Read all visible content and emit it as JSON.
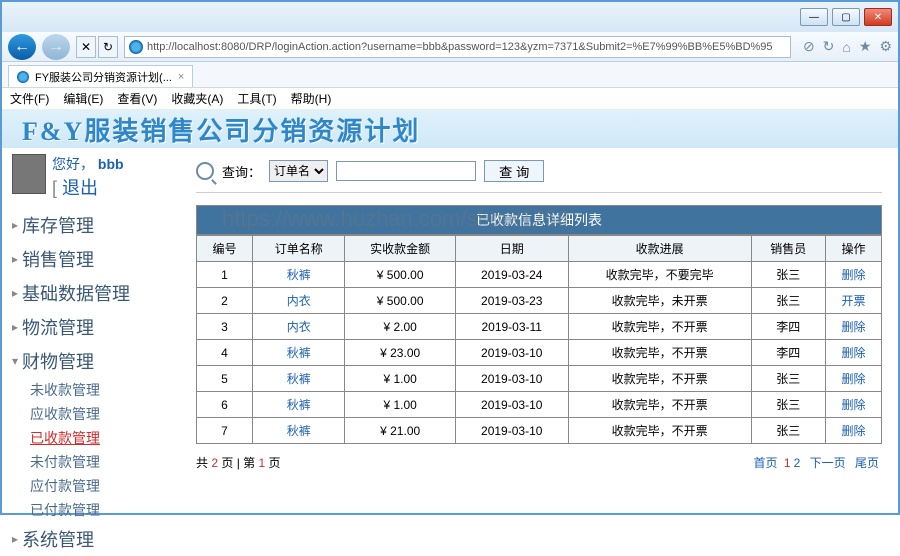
{
  "window": {
    "url_display": "http://localhost:8080/DRP/loginAction.action?username=bbb&password=123&yzm=7371&Submit2=%E7%99%BB%E5%BD%95",
    "tab_title": "FY服装公司分销资源计划(...",
    "min": "—",
    "max": "▢",
    "close": "✕"
  },
  "menu": [
    "文件(F)",
    "编辑(E)",
    "查看(V)",
    "收藏夹(A)",
    "工具(T)",
    "帮助(H)"
  ],
  "banner": "F&Y服装销售公司分销资源计划",
  "sidebar": {
    "hello_prefix": "您好，",
    "username": "bbb",
    "logout": "退出",
    "top_items": [
      "库存管理",
      "销售管理",
      "基础数据管理",
      "物流管理",
      "财物管理",
      "系统管理"
    ],
    "open_index": 4,
    "sub_items": [
      "未收款管理",
      "应收款管理",
      "已收款管理",
      "未付款管理",
      "应付款管理",
      "已付款管理"
    ],
    "active_sub_index": 2
  },
  "search": {
    "label": "查询：",
    "select_value": "订单名",
    "input_value": "",
    "button": "查 询"
  },
  "table": {
    "title": "已收款信息详细列表",
    "headers": [
      "编号",
      "订单名称",
      "实收款金额",
      "日期",
      "收款进展",
      "销售员",
      "操作"
    ],
    "rows": [
      {
        "id": "1",
        "name": "秋裤",
        "amount": "¥ 500.00",
        "date": "2019-03-24",
        "progress": "收款完毕，不要完毕",
        "seller": "张三",
        "op": "删除"
      },
      {
        "id": "2",
        "name": "内衣",
        "amount": "¥ 500.00",
        "date": "2019-03-23",
        "progress": "收款完毕，未开票",
        "seller": "张三",
        "op": "开票"
      },
      {
        "id": "3",
        "name": "内衣",
        "amount": "¥ 2.00",
        "date": "2019-03-11",
        "progress": "收款完毕，不开票",
        "seller": "李四",
        "op": "删除"
      },
      {
        "id": "4",
        "name": "秋裤",
        "amount": "¥ 23.00",
        "date": "2019-03-10",
        "progress": "收款完毕，不开票",
        "seller": "李四",
        "op": "删除"
      },
      {
        "id": "5",
        "name": "秋裤",
        "amount": "¥ 1.00",
        "date": "2019-03-10",
        "progress": "收款完毕，不开票",
        "seller": "张三",
        "op": "删除"
      },
      {
        "id": "6",
        "name": "秋裤",
        "amount": "¥ 1.00",
        "date": "2019-03-10",
        "progress": "收款完毕，不开票",
        "seller": "张三",
        "op": "删除"
      },
      {
        "id": "7",
        "name": "秋裤",
        "amount": "¥ 21.00",
        "date": "2019-03-10",
        "progress": "收款完毕，不开票",
        "seller": "张三",
        "op": "删除"
      }
    ]
  },
  "pager": {
    "left_prefix": "共 ",
    "total_pages": "2",
    "left_mid": " 页 | 第 ",
    "current_page": "1",
    "left_suffix": " 页",
    "first": "首页",
    "p1": "1",
    "p2": "2",
    "next": "下一页",
    "last": "尾页"
  },
  "watermark": "https://www.huzhan.com/shop/1758"
}
